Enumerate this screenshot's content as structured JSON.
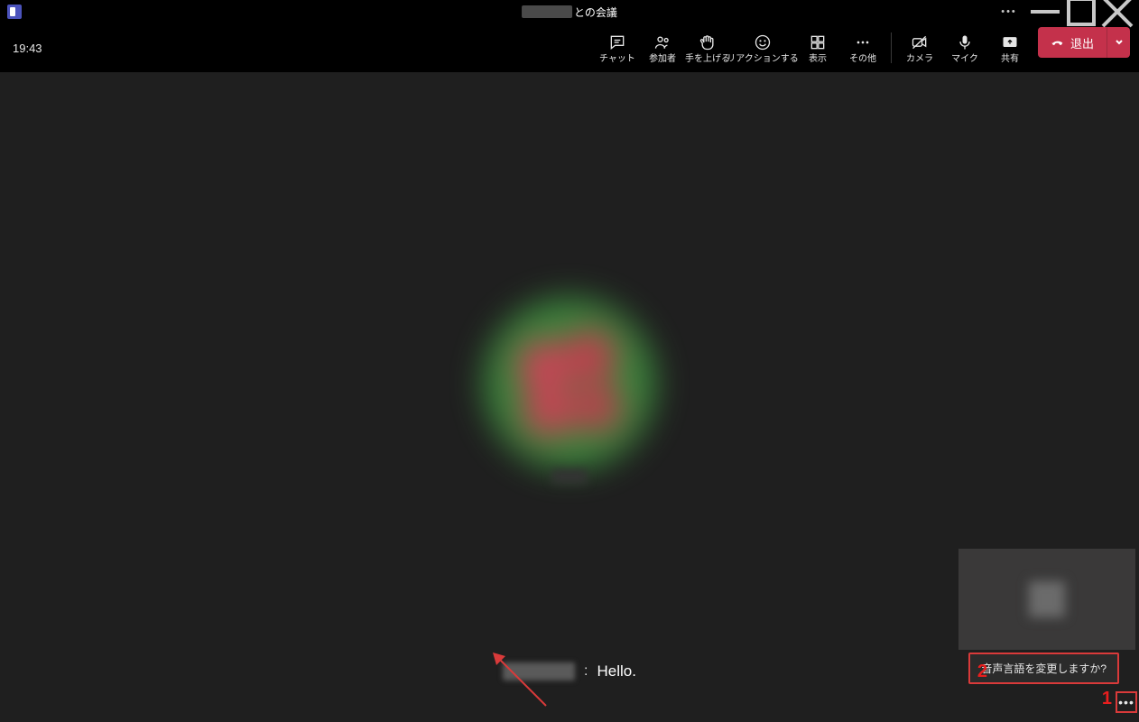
{
  "titlebar": {
    "title_suffix": "との会議"
  },
  "toolbar": {
    "timer": "19:43",
    "buttons": {
      "chat": "チャット",
      "participants": "参加者",
      "raise_hand": "手を上げる",
      "reactions": "リアクションする",
      "view": "表示",
      "more": "その他",
      "camera": "カメラ",
      "mic": "マイク",
      "share": "共有"
    },
    "leave": "退出"
  },
  "caption": {
    "text": "Hello."
  },
  "tooltip": {
    "text": "音声言語を変更しますか?"
  },
  "annotations": {
    "num1": "1",
    "num2": "2"
  }
}
